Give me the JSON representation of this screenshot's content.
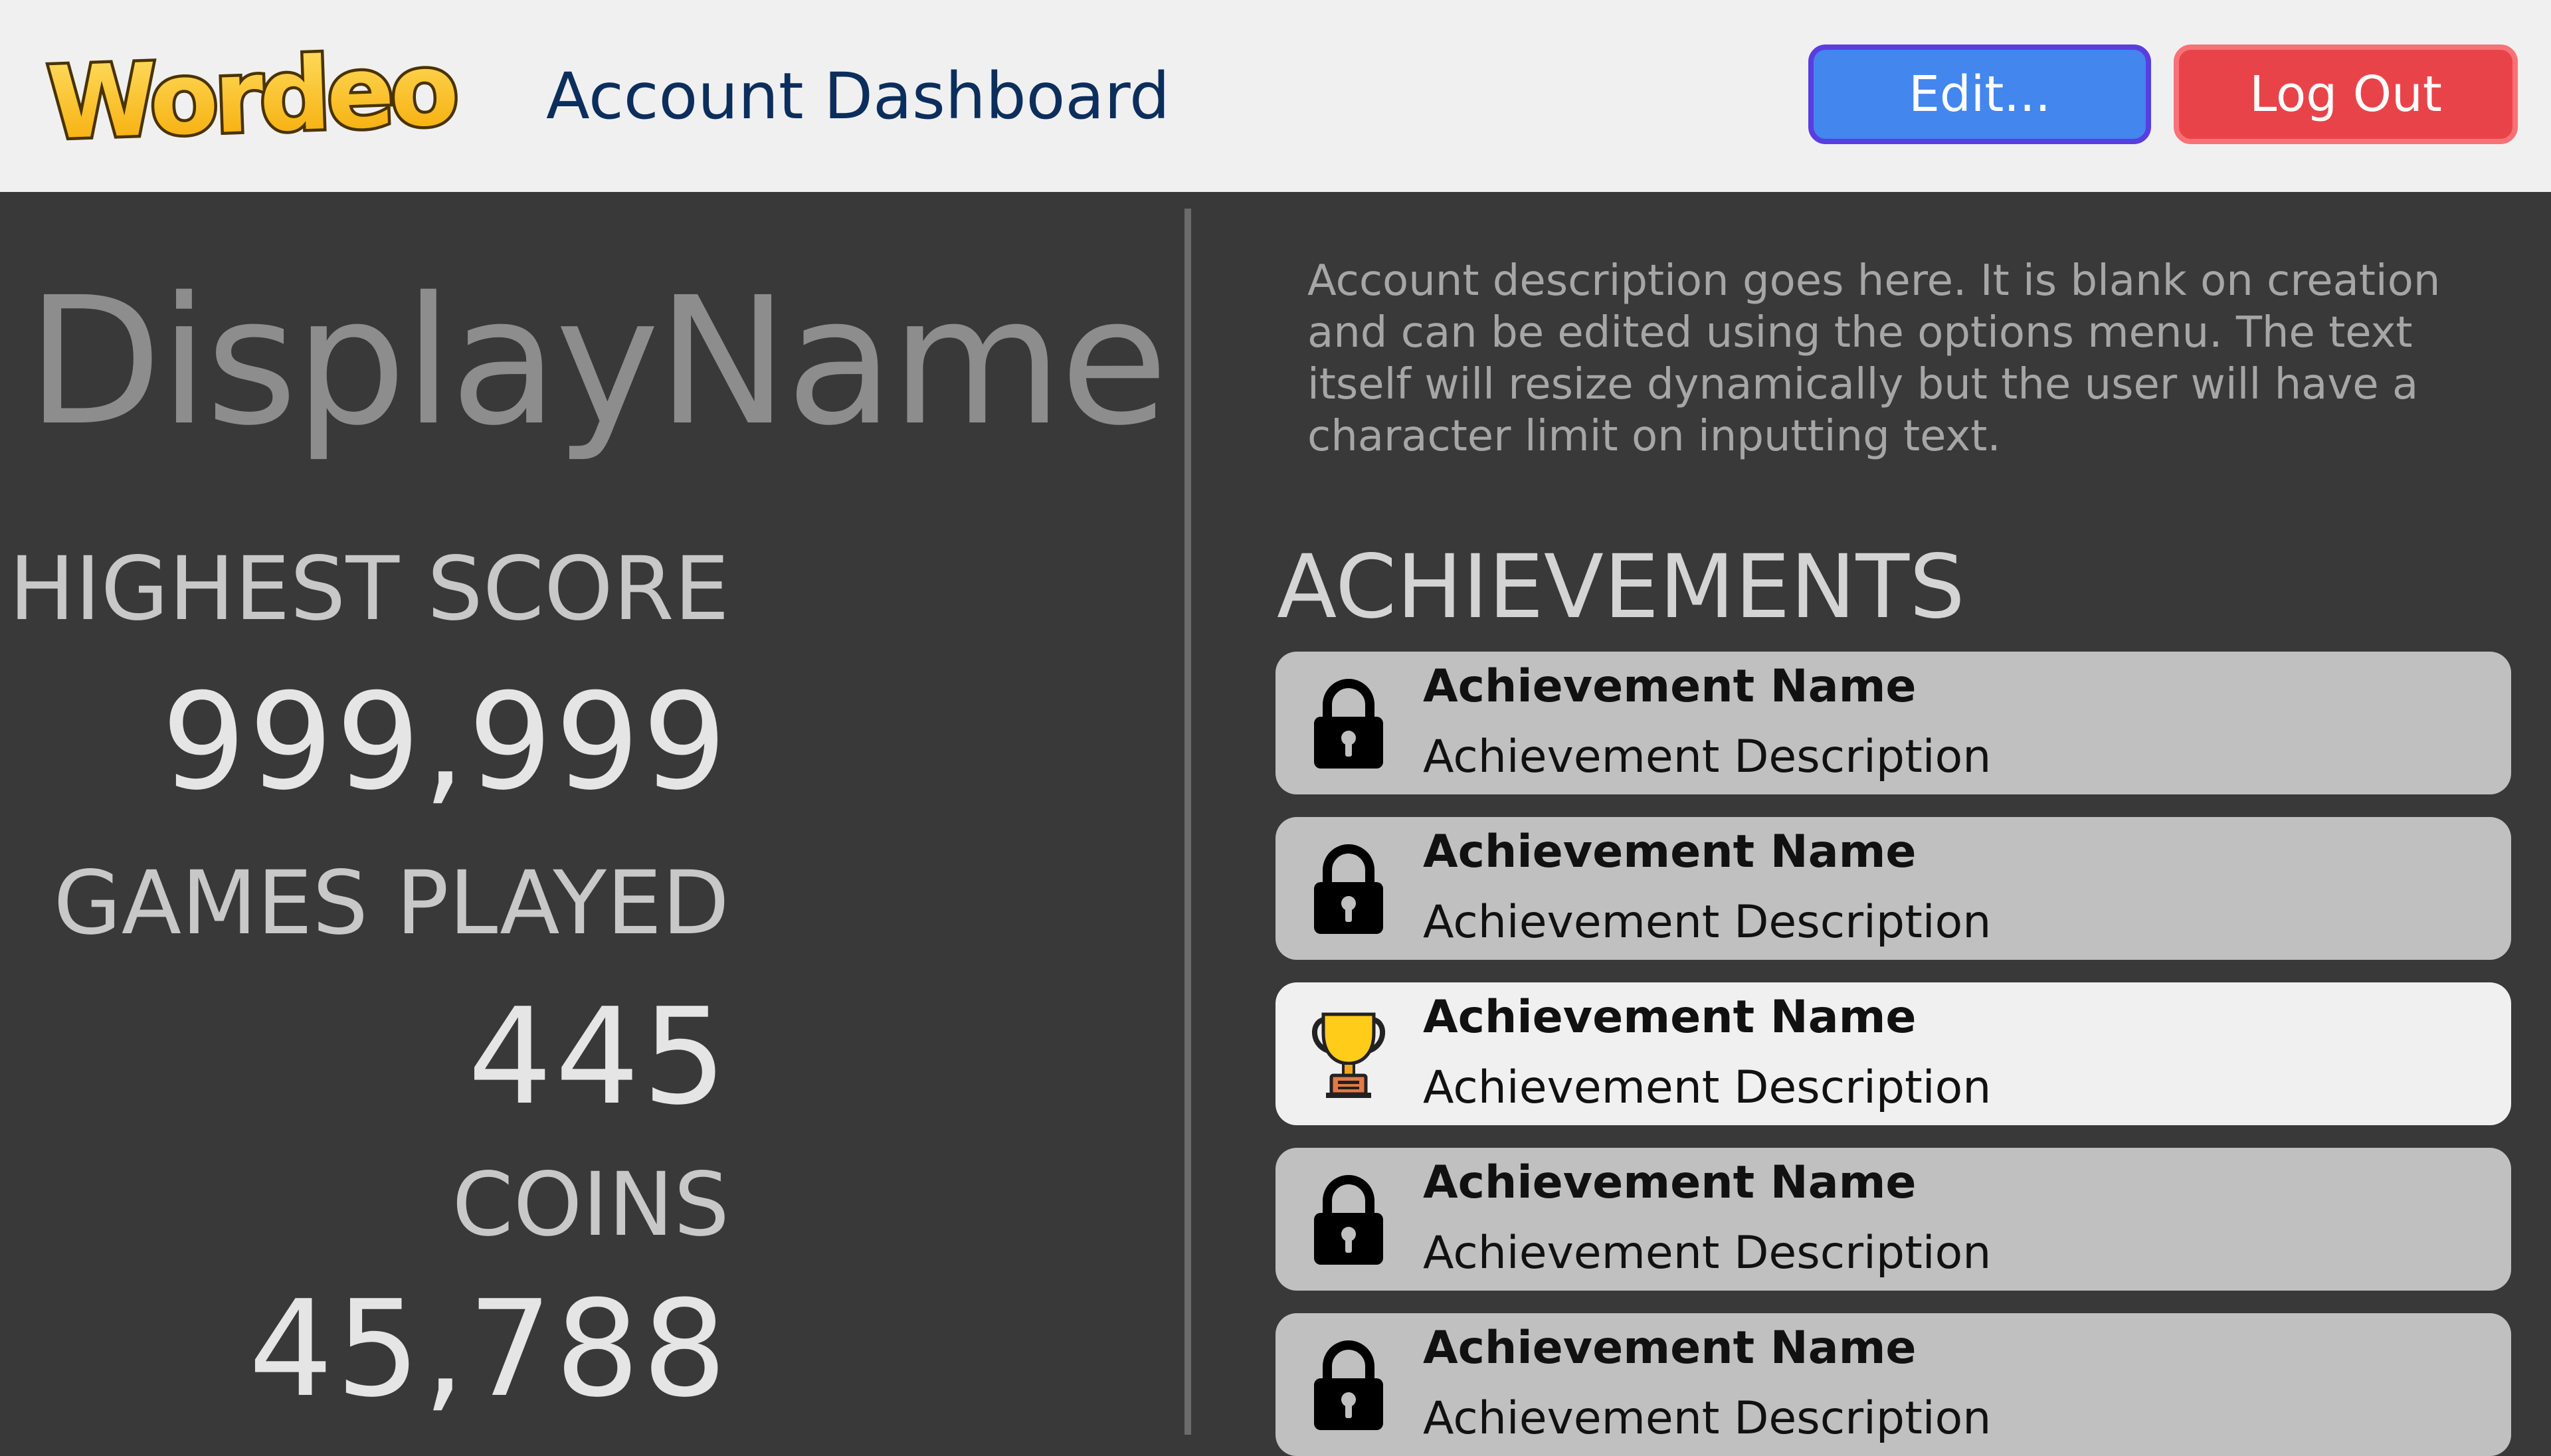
{
  "header": {
    "logo_text": "Wordeo",
    "title": "Account Dashboard",
    "edit_label": "Edit...",
    "logout_label": "Log Out"
  },
  "profile": {
    "display_name": "DisplayName",
    "description": "Account description goes here. It is blank on creation and can be edited using the options menu. The text itself will resize dynamically but the user will have a character limit on inputting text."
  },
  "stats": {
    "highest_score_label": "HIGHEST SCORE",
    "highest_score_value": "999,999",
    "games_played_label": "GAMES PLAYED",
    "games_played_value": "445",
    "coins_label": "COINS",
    "coins_value": "45,788"
  },
  "achievements": {
    "heading": "ACHIEVEMENTS",
    "items": [
      {
        "name": "Achievement Name",
        "description": "Achievement Description",
        "icon": "lock-icon",
        "unlocked": false
      },
      {
        "name": "Achievement Name",
        "description": "Achievement Description",
        "icon": "lock-icon",
        "unlocked": false
      },
      {
        "name": "Achievement Name",
        "description": "Achievement Description",
        "icon": "trophy-icon",
        "unlocked": true
      },
      {
        "name": "Achievement Name",
        "description": "Achievement Description",
        "icon": "lock-icon",
        "unlocked": false
      },
      {
        "name": "Achievement Name",
        "description": "Achievement Description",
        "icon": "lock-icon",
        "unlocked": false
      }
    ]
  },
  "colors": {
    "edit_button": "#4286ee",
    "logout_button": "#e9434a",
    "background": "#393939",
    "header_bg": "#f0f0f0",
    "card_locked": "#c0c0c0",
    "card_unlocked": "#f0f0f0"
  }
}
